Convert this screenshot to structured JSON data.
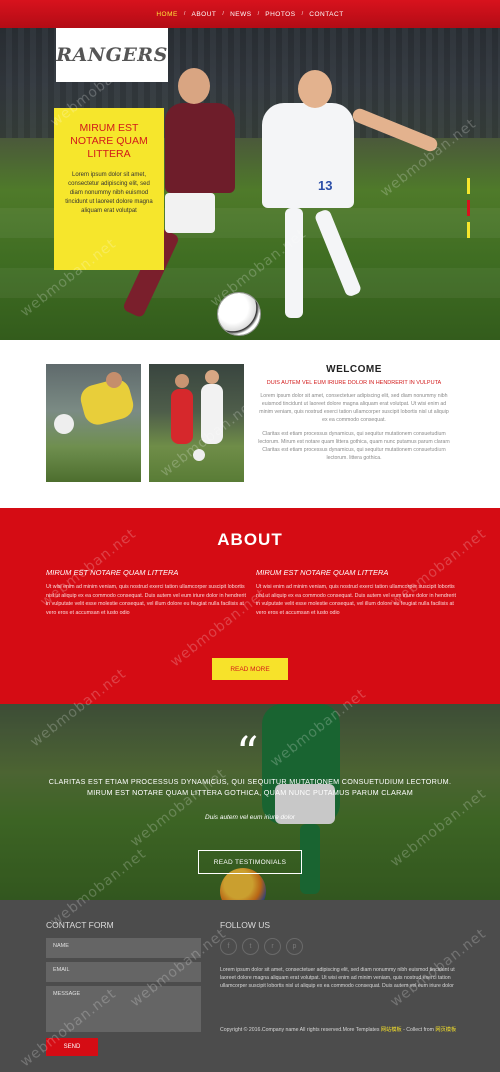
{
  "nav": {
    "items": [
      {
        "label": "HOME",
        "active": true
      },
      {
        "label": "ABOUT",
        "active": false
      },
      {
        "label": "NEWS",
        "active": false
      },
      {
        "label": "PHOTOS",
        "active": false
      },
      {
        "label": "CONTACT",
        "active": false
      }
    ],
    "separator": "/"
  },
  "hero": {
    "logo": "RANGERS",
    "card_title": "MIRUM EST NOTARE QUAM LITTERA",
    "card_text": "Lorem ipsum dolor sit amet, consectetur adipiscing elit, sed diam nonummy nibh euismod tincidunt ut laoreet dolore magna aliquam erat volutpat",
    "jersey_number": "13"
  },
  "welcome": {
    "title": "WELCOME",
    "subtitle": "DUIS AUTEM VEL EUM IRIURE DOLOR IN HENDRERIT IN VULPUTA",
    "para1": "Lorem ipsum dolor sit amet, consectetuer adipiscing elit, sed diam nonummy nibh euismod tincidunt ut laoreet dolore magna aliquam erat volutpat. Ut wisi enim ad minim veniam, quis nostrud exerci tation ullamcorper suscipit lobortis nisl ut aliquip ex ea commodo consequat.",
    "para2": "Claritas est etiam processus dynamicus, qui sequitur mutationem consuetudium lectorum. Mirum est notare quam littera gothica, quam nunc putamus parum claram Claritas est etiam processus dynamicus, qui sequitur mutationem consuetudium lectorum. littera gothica."
  },
  "about": {
    "title": "ABOUT",
    "col1_title": "MIRUM EST NOTARE QUAM LITTERA",
    "col1_text": "Ut wisi enim ad minim veniam, quis nostrud exerci tation ullamcorper suscipit lobortis nisl ut aliquip ex ea commodo consequat. Duis autem vel eum iriure dolor in hendrerit in vulputate velit esse molestie consequat, vel illum dolore eu feugiat nulla facilisis at vero eros et accumsan et iusto odio",
    "col2_title": "MIRUM EST NOTARE QUAM LITTERA",
    "col2_text": "Ut wisi enim ad minim veniam, quis nostrud exerci tation ullamcorper suscipit lobortis nisl ut aliquip ex ea commodo consequat. Duis autem vel eum iriure dolor in hendrerit in vulputate velit esse molestie consequat, vel illum dolore eu feugiat nulla facilisis at vero eros et accumsan et iusto odio",
    "button": "READ MORE"
  },
  "testimonial": {
    "quote_mark": "“",
    "text": "CLARITAS EST ETIAM PROCESSUS DYNAMICUS, QUI SEQUITUR MUTATIONEM CONSUETUDIUM LECTORUM. MIRUM EST NOTARE QUAM LITTERA GOTHICA, QUAM NUNC PUTAMUS PARUM CLARAM",
    "author": "Duis autem vel eum iriure dolor",
    "button": "READ TESTIMONIALS"
  },
  "footer": {
    "contact_title": "CONTACT FORM",
    "name_placeholder": "NAME",
    "email_placeholder": "EMAIL",
    "message_placeholder": "MESSAGE",
    "send": "SEND",
    "follow_title": "FOLLOW US",
    "socials": [
      {
        "icon": "facebook-icon",
        "glyph": "f"
      },
      {
        "icon": "twitter-icon",
        "glyph": "t"
      },
      {
        "icon": "rss-icon",
        "glyph": "r"
      },
      {
        "icon": "pinterest-icon",
        "glyph": "p"
      }
    ],
    "text": "Lorem ipsum dolor sit amet, consectetuer adipiscing elit, sed diam nonummy nibh euismod tincidunt ut laoreet dolore magna aliquam erat volutpat. Ut wisi enim ad minim veniam, quis nostrud exerci tation ullamcorper suscipit lobortis nisl ut aliquip ex ea commodo consequat. Duis autem vel eum iriure dolor",
    "copyright": "Copyright © 2016.Company name All rights reserved.More Templates",
    "copyright_link1": "网站模板",
    "copyright_mid": " - Collect from ",
    "copyright_link2": "网页模板"
  },
  "watermark": "webmoban.net",
  "colors": {
    "brand_red": "#d50c14",
    "accent_yellow": "#f7e22a",
    "footer_gray": "#4c4c4c"
  }
}
